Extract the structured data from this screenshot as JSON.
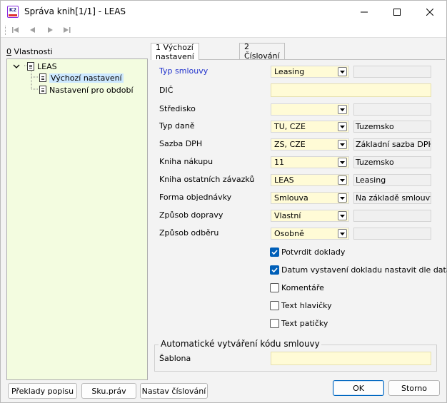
{
  "window": {
    "title": "Správa knih[1/1] - LEAS",
    "app_icon_text": "K2"
  },
  "left_panel": {
    "label_prefix": "0",
    "label_rest": " Vlastnosti",
    "tree": {
      "root": "LEAS",
      "children": [
        "Výchozí nastavení",
        "Nastavení pro období"
      ]
    }
  },
  "tabs": [
    "1 Výchozí nastavení",
    "2 Číslování"
  ],
  "form": {
    "typ_smlouvy": {
      "label": "Typ smlouvy",
      "value": "Leasing",
      "desc": ""
    },
    "dic": {
      "label": "DIČ",
      "value": ""
    },
    "stredisko": {
      "label": "Středisko",
      "value": "",
      "desc": ""
    },
    "typ_dane": {
      "label": "Typ daně",
      "value": "TU, CZE",
      "desc": "Tuzemsko"
    },
    "sazba_dph": {
      "label": "Sazba DPH",
      "value": "ZS, CZE",
      "desc": "Základní sazba DPH"
    },
    "kniha_nakupu": {
      "label": "Kniha nákupu",
      "value": "11",
      "desc": "Tuzemsko"
    },
    "kniha_ostatnich": {
      "label": "Kniha ostatních závazků",
      "value": "LEAS",
      "desc": "Leasing"
    },
    "forma_objednavky": {
      "label": "Forma objednávky",
      "value": "Smlouva",
      "desc": "Na základě smlouvy"
    },
    "zpusob_dopravy": {
      "label": "Způsob dopravy",
      "value": "Vlastní",
      "desc": ""
    },
    "zpusob_odberu": {
      "label": "Způsob odběru",
      "value": "Osobně",
      "desc": ""
    }
  },
  "checkboxes": [
    {
      "label": "Potvrdit doklady",
      "checked": true
    },
    {
      "label": "Datum vystavení dokladu nastavit dle data u",
      "checked": true
    },
    {
      "label": "Komentáře",
      "checked": false
    },
    {
      "label": "Text hlavičky",
      "checked": false
    },
    {
      "label": "Text patičky",
      "checked": false
    }
  ],
  "group": {
    "title": "Automatické vytváření kódu smlouvy",
    "sablona_label": "Šablona",
    "sablona_value": ""
  },
  "buttons": {
    "preklady": "Překlady popisu",
    "skuprav": "Sku.práv",
    "nastav_cislovani": "Nastav číslování",
    "ok": "OK",
    "storno": "Storno"
  },
  "colors": {
    "required_label": "#2233cc",
    "tree_bg": "#f3fce0",
    "field_bg": "#fffbd6",
    "checkbox_on": "#005fb8"
  }
}
